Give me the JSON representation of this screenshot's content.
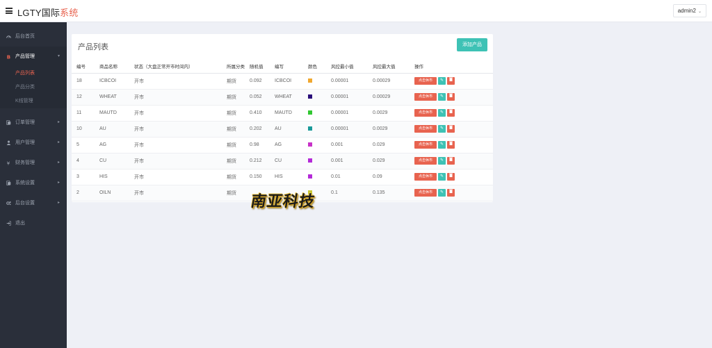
{
  "header": {
    "brand_main": "LGTY国际",
    "brand_accent": "系统",
    "user": "admin2",
    "user_caret": "⌄"
  },
  "sidebar": {
    "items": [
      {
        "label": "后台首页",
        "icon": "dashboard-icon"
      },
      {
        "label": "产品管理",
        "icon": "bitcoin-icon",
        "active": true,
        "children": [
          {
            "label": "产品列表",
            "active": true
          },
          {
            "label": "产品分类"
          },
          {
            "label": "K线管理"
          }
        ]
      },
      {
        "label": "订单管理",
        "icon": "orders-icon"
      },
      {
        "label": "用户管理",
        "icon": "user-icon"
      },
      {
        "label": "财务管理",
        "icon": "yen-icon"
      },
      {
        "label": "系统设置",
        "icon": "settings-icon"
      },
      {
        "label": "后台设置",
        "icon": "cogs-icon"
      },
      {
        "label": "退出",
        "icon": "logout-icon"
      }
    ]
  },
  "card": {
    "title": "产品列表",
    "add_button": "添加产品"
  },
  "table": {
    "columns": [
      "编号",
      "商品名称",
      "状态（大盘正常开市时间内）",
      "所属分类",
      "随机值",
      "编写",
      "颜色",
      "风控最小值",
      "风控最大值",
      "操作"
    ],
    "rows": [
      {
        "id": "18",
        "name": "ICBCOI",
        "status": "开市",
        "category": "期货",
        "random": "0.092",
        "code": "ICBCOI",
        "color": "#f0a830",
        "min": "0.00001",
        "max": "0.00029"
      },
      {
        "id": "12",
        "name": "WHEAT",
        "status": "开市",
        "category": "期货",
        "random": "0.052",
        "code": "WHEAT",
        "color": "#2a0f7a",
        "min": "0.00001",
        "max": "0.00029"
      },
      {
        "id": "11",
        "name": "MAUTD",
        "status": "开市",
        "category": "期货",
        "random": "0.410",
        "code": "MAUTD",
        "color": "#32c832",
        "min": "0.00001",
        "max": "0.0029"
      },
      {
        "id": "10",
        "name": "AU",
        "status": "开市",
        "category": "期货",
        "random": "0.202",
        "code": "AU",
        "color": "#1a9a9a",
        "min": "0.00001",
        "max": "0.0029"
      },
      {
        "id": "5",
        "name": "AG",
        "status": "开市",
        "category": "期货",
        "random": "0.98",
        "code": "AG",
        "color": "#c832c8",
        "min": "0.001",
        "max": "0.029"
      },
      {
        "id": "4",
        "name": "CU",
        "status": "开市",
        "category": "期货",
        "random": "0.212",
        "code": "CU",
        "color": "#b42ad8",
        "min": "0.001",
        "max": "0.029"
      },
      {
        "id": "3",
        "name": "HIS",
        "status": "开市",
        "category": "期货",
        "random": "0.150",
        "code": "HIS",
        "color": "#b42ad8",
        "min": "0.01",
        "max": "0.09"
      },
      {
        "id": "2",
        "name": "OILN",
        "status": "开市",
        "category": "期货",
        "random": "",
        "code": "",
        "color": "#c8c832",
        "min": "0.1",
        "max": "0.135"
      }
    ],
    "action_toggle": "点击休市",
    "action_edit_icon": "✎",
    "action_delete_icon": "🗑"
  },
  "watermark": {
    "text": "南亚科技"
  }
}
